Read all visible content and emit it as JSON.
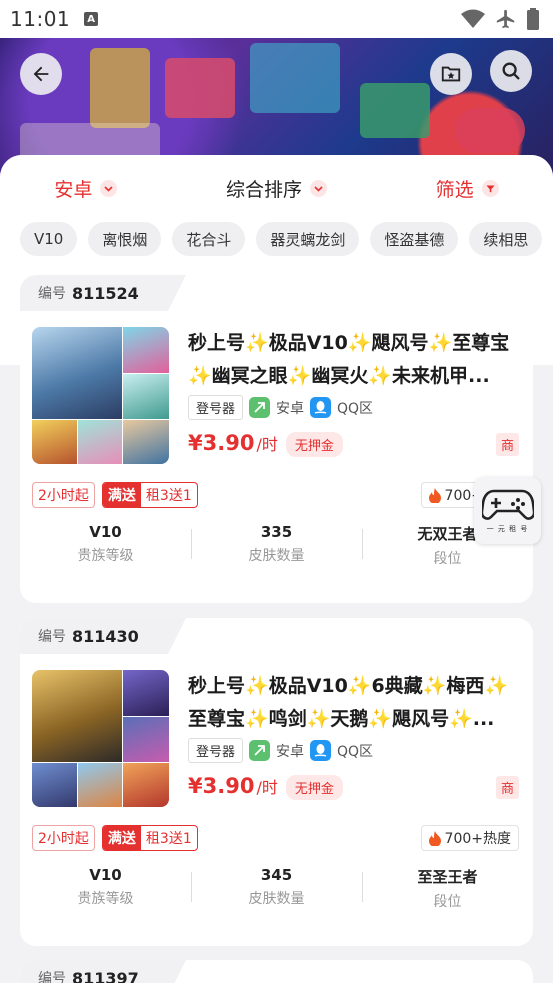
{
  "status_bar": {
    "time": "11:01",
    "a_label": "A"
  },
  "filters": {
    "platform": "安卓",
    "sort": "综合排序",
    "filter": "筛选"
  },
  "chips": [
    "V10",
    "离恨烟",
    "花合斗",
    "器灵螭龙剑",
    "怪盗基德",
    "续相思"
  ],
  "listings": [
    {
      "id_label": "编号",
      "id": "811524",
      "title_parts": [
        "秒上号",
        "极品V10",
        "飓风号",
        "至尊宝",
        "",
        "幽冥之眼",
        "幽冥火",
        "未来机甲..."
      ],
      "login_tag": "登号器",
      "os": "安卓",
      "zone": "QQ区",
      "price": "¥3.90",
      "price_unit": "/时",
      "deposit": "无押金",
      "merchant": "商",
      "min_time": "2小时起",
      "promo_label": "满送",
      "promo_detail": "租3送1",
      "heat": "700+热度",
      "stats": [
        {
          "value": "V10",
          "label": "贵族等级"
        },
        {
          "value": "335",
          "label": "皮肤数量"
        },
        {
          "value": "无双王者",
          "label": "段位"
        }
      ]
    },
    {
      "id_label": "编号",
      "id": "811430",
      "title_parts": [
        "秒上号",
        "极品V10",
        "6典藏",
        "梅西",
        "",
        "至尊宝",
        "鸣剑",
        "天鹅",
        "飓风号",
        "..."
      ],
      "login_tag": "登号器",
      "os": "安卓",
      "zone": "QQ区",
      "price": "¥3.90",
      "price_unit": "/时",
      "deposit": "无押金",
      "merchant": "商",
      "min_time": "2小时起",
      "promo_label": "满送",
      "promo_detail": "租3送1",
      "heat": "700+热度",
      "stats": [
        {
          "value": "V10",
          "label": "贵族等级"
        },
        {
          "value": "345",
          "label": "皮肤数量"
        },
        {
          "value": "至圣王者",
          "label": "段位"
        }
      ]
    },
    {
      "id_label": "编号",
      "id": "811397"
    }
  ],
  "float_widget": {
    "caption": "一 元 租 号"
  },
  "colors": {
    "accent": "#e53030",
    "chip_bg": "#efeff1",
    "page_bg": "#f2f2f4"
  }
}
